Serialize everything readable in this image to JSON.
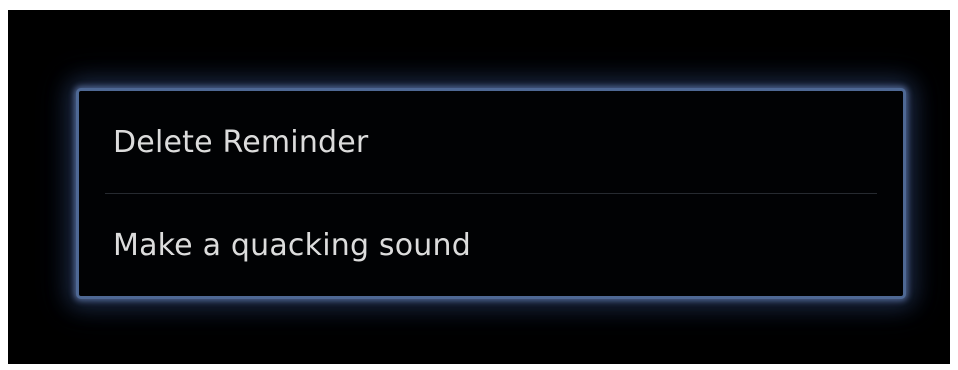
{
  "context_menu": {
    "items": [
      {
        "label": "Delete Reminder"
      },
      {
        "label": "Make a quacking sound"
      }
    ]
  },
  "colors": {
    "background": "#000000",
    "menu_border_glow": "#4e6894",
    "text": "#dcdcdc"
  }
}
